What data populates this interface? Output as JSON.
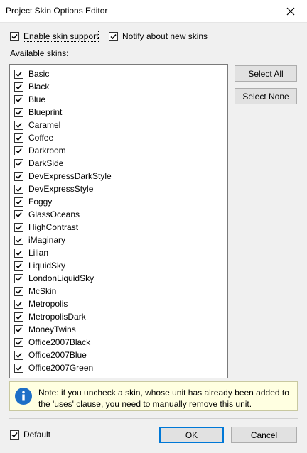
{
  "window": {
    "title": "Project Skin Options Editor"
  },
  "options": {
    "enable_skin_support": {
      "label": "Enable skin support",
      "checked": true
    },
    "notify_new_skins": {
      "label": "Notify about new skins",
      "checked": true
    }
  },
  "available_label": "Available skins:",
  "skins": [
    "Basic",
    "Black",
    "Blue",
    "Blueprint",
    "Caramel",
    "Coffee",
    "Darkroom",
    "DarkSide",
    "DevExpressDarkStyle",
    "DevExpressStyle",
    "Foggy",
    "GlassOceans",
    "HighContrast",
    "iMaginary",
    "Lilian",
    "LiquidSky",
    "LondonLiquidSky",
    "McSkin",
    "Metropolis",
    "MetropolisDark",
    "MoneyTwins",
    "Office2007Black",
    "Office2007Blue",
    "Office2007Green"
  ],
  "buttons": {
    "select_all": "Select All",
    "select_none": "Select None",
    "ok": "OK",
    "cancel": "Cancel"
  },
  "note": {
    "icon": "info-icon",
    "text": "Note: if you uncheck a skin, whose unit has already been added to the 'uses' clause, you need to manually remove this unit."
  },
  "default_option": {
    "label": "Default",
    "checked": true
  },
  "colors": {
    "accent": "#0078d7",
    "note_bg": "#ffffe1"
  }
}
